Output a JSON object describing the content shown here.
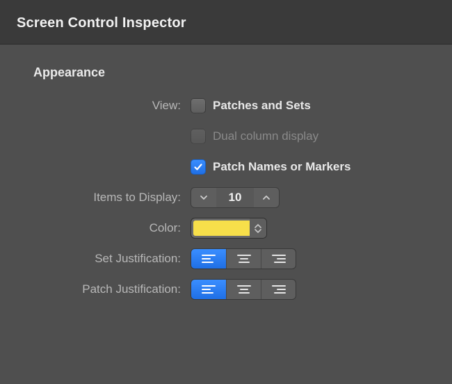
{
  "window": {
    "title": "Screen Control Inspector"
  },
  "section": {
    "heading": "Appearance"
  },
  "labels": {
    "view": "View:",
    "items": "Items to Display:",
    "color": "Color:",
    "setJust": "Set Justification:",
    "patchJust": "Patch Justification:"
  },
  "view": {
    "opt0": {
      "label": "Patches and Sets",
      "checked": false,
      "disabled": false
    },
    "opt1": {
      "label": "Dual column display",
      "checked": false,
      "disabled": true
    },
    "opt2": {
      "label": "Patch Names or Markers",
      "checked": true,
      "disabled": false
    }
  },
  "items": {
    "value": "10"
  },
  "color": {
    "hex": "#f7df4a"
  },
  "setJust": {
    "value": "left"
  },
  "patchJust": {
    "value": "left"
  }
}
